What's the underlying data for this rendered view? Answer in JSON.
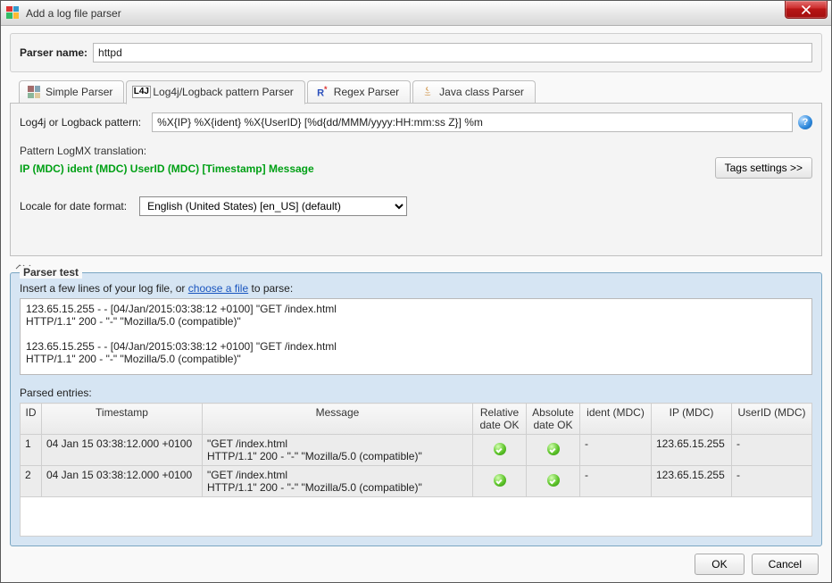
{
  "window": {
    "title": "Add a log file parser"
  },
  "parser_name": {
    "label": "Parser name:",
    "value": "httpd"
  },
  "tabs": [
    {
      "label": "Simple Parser"
    },
    {
      "label": "Log4j/Logback pattern Parser"
    },
    {
      "label": "Regex Parser"
    },
    {
      "label": "Java class Parser"
    }
  ],
  "active_tab": 1,
  "pattern": {
    "label": "Log4j or Logback pattern:",
    "value": "%X{IP} %X{ident} %X{UserID} [%d{dd/MMM/yyyy:HH:mm:ss Z}] %m"
  },
  "translation": {
    "label": "Pattern LogMX translation:",
    "fields": "IP (MDC) ident (MDC) UserID (MDC) [Timestamp] Message",
    "parts": [
      "IP (MDC)",
      "ident (MDC)",
      "UserID (MDC)",
      "[",
      "Timestamp",
      "]",
      "Message"
    ]
  },
  "tags_button": "Tags settings >>",
  "locale": {
    "label": "Locale for date format:",
    "value": "English (United States) [en_US]    (default)"
  },
  "test": {
    "legend": "Parser test",
    "hint_prefix": "Insert a few lines of your log file, or ",
    "hint_link": "choose a file",
    "hint_suffix": " to parse:",
    "sample": "123.65.15.255 - - [04/Jan/2015:03:38:12 +0100] \"GET /index.html\nHTTP/1.1\" 200 - \"-\" \"Mozilla/5.0 (compatible)\"\n\n123.65.15.255 - - [04/Jan/2015:03:38:12 +0100] \"GET /index.html\nHTTP/1.1\" 200 - \"-\" \"Mozilla/5.0 (compatible)\"",
    "parsed_label": "Parsed entries:"
  },
  "grid": {
    "headers": [
      "ID",
      "Timestamp",
      "Message",
      "Relative date OK",
      "Absolute date OK",
      "ident (MDC)",
      "IP (MDC)",
      "UserID (MDC)"
    ],
    "rows": [
      {
        "id": "1",
        "ts": "04 Jan 15 03:38:12.000 +0100",
        "msg": "\"GET /index.html\nHTTP/1.1\" 200 - \"-\" \"Mozilla/5.0 (compatible)\"",
        "rel_ok": true,
        "abs_ok": true,
        "ident": "-",
        "ip": "123.65.15.255",
        "userid": "-"
      },
      {
        "id": "2",
        "ts": "04 Jan 15 03:38:12.000 +0100",
        "msg": "\"GET /index.html\nHTTP/1.1\" 200 - \"-\" \"Mozilla/5.0 (compatible)\"",
        "rel_ok": true,
        "abs_ok": true,
        "ident": "-",
        "ip": "123.65.15.255",
        "userid": "-"
      }
    ]
  },
  "buttons": {
    "ok": "OK",
    "cancel": "Cancel"
  }
}
